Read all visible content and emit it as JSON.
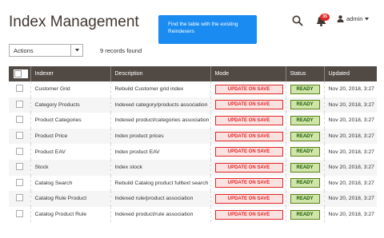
{
  "page": {
    "title": "Index Management"
  },
  "tooltip": {
    "text": "Find the table with the existing Reindexers"
  },
  "header": {
    "notification_count": "35",
    "user_name": "admin"
  },
  "toolbar": {
    "actions_label": "Actions",
    "records_text": "9 records found"
  },
  "grid": {
    "columns": [
      "Indexer",
      "Description",
      "Mode",
      "Status",
      "Updated"
    ],
    "rows": [
      {
        "indexer": "Customer Grid",
        "description": "Rebuild Customer grid index",
        "mode": "UPDATE ON SAVE",
        "status": "READY",
        "updated": "Nov 20, 2018, 3:27"
      },
      {
        "indexer": "Category Products",
        "description": "Indexed category/products association",
        "mode": "UPDATE ON SAVE",
        "status": "READY",
        "updated": "Nov 20, 2018, 3:27"
      },
      {
        "indexer": "Product Categories",
        "description": "Indexed product/categories association",
        "mode": "UPDATE ON SAVE",
        "status": "READY",
        "updated": "Nov 20, 2018, 3:27"
      },
      {
        "indexer": "Product Price",
        "description": "Index product prices",
        "mode": "UPDATE ON SAVE",
        "status": "READY",
        "updated": "Nov 20, 2018, 3:27"
      },
      {
        "indexer": "Product EAV",
        "description": "Index product EAV",
        "mode": "UPDATE ON SAVE",
        "status": "READY",
        "updated": "Nov 20, 2018, 3:27"
      },
      {
        "indexer": "Stock",
        "description": "Index stock",
        "mode": "UPDATE ON SAVE",
        "status": "READY",
        "updated": "Nov 20, 2018, 3:27"
      },
      {
        "indexer": "Catalog Search",
        "description": "Rebuild Catalog product fulltext search",
        "mode": "UPDATE ON SAVE",
        "status": "READY",
        "updated": "Nov 20, 2018, 3:27"
      },
      {
        "indexer": "Catalog Rule Product",
        "description": "Indexed rule/product association",
        "mode": "UPDATE ON SAVE",
        "status": "READY",
        "updated": "Nov 20, 2018, 3:27"
      },
      {
        "indexer": "Catalog Product Rule",
        "description": "Indexed product/rule association",
        "mode": "UPDATE ON SAVE",
        "status": "READY",
        "updated": "Nov 20, 2018, 3:27"
      }
    ]
  },
  "colors": {
    "header_bg": "#514943",
    "tooltip_bg": "#1a8bf0",
    "mode_red": "#e22626",
    "status_green": "#5b8116"
  },
  "icons": {
    "search": "search-icon",
    "notifications": "bell-icon",
    "user": "user-icon",
    "dropdown": "chevron-down-icon"
  }
}
